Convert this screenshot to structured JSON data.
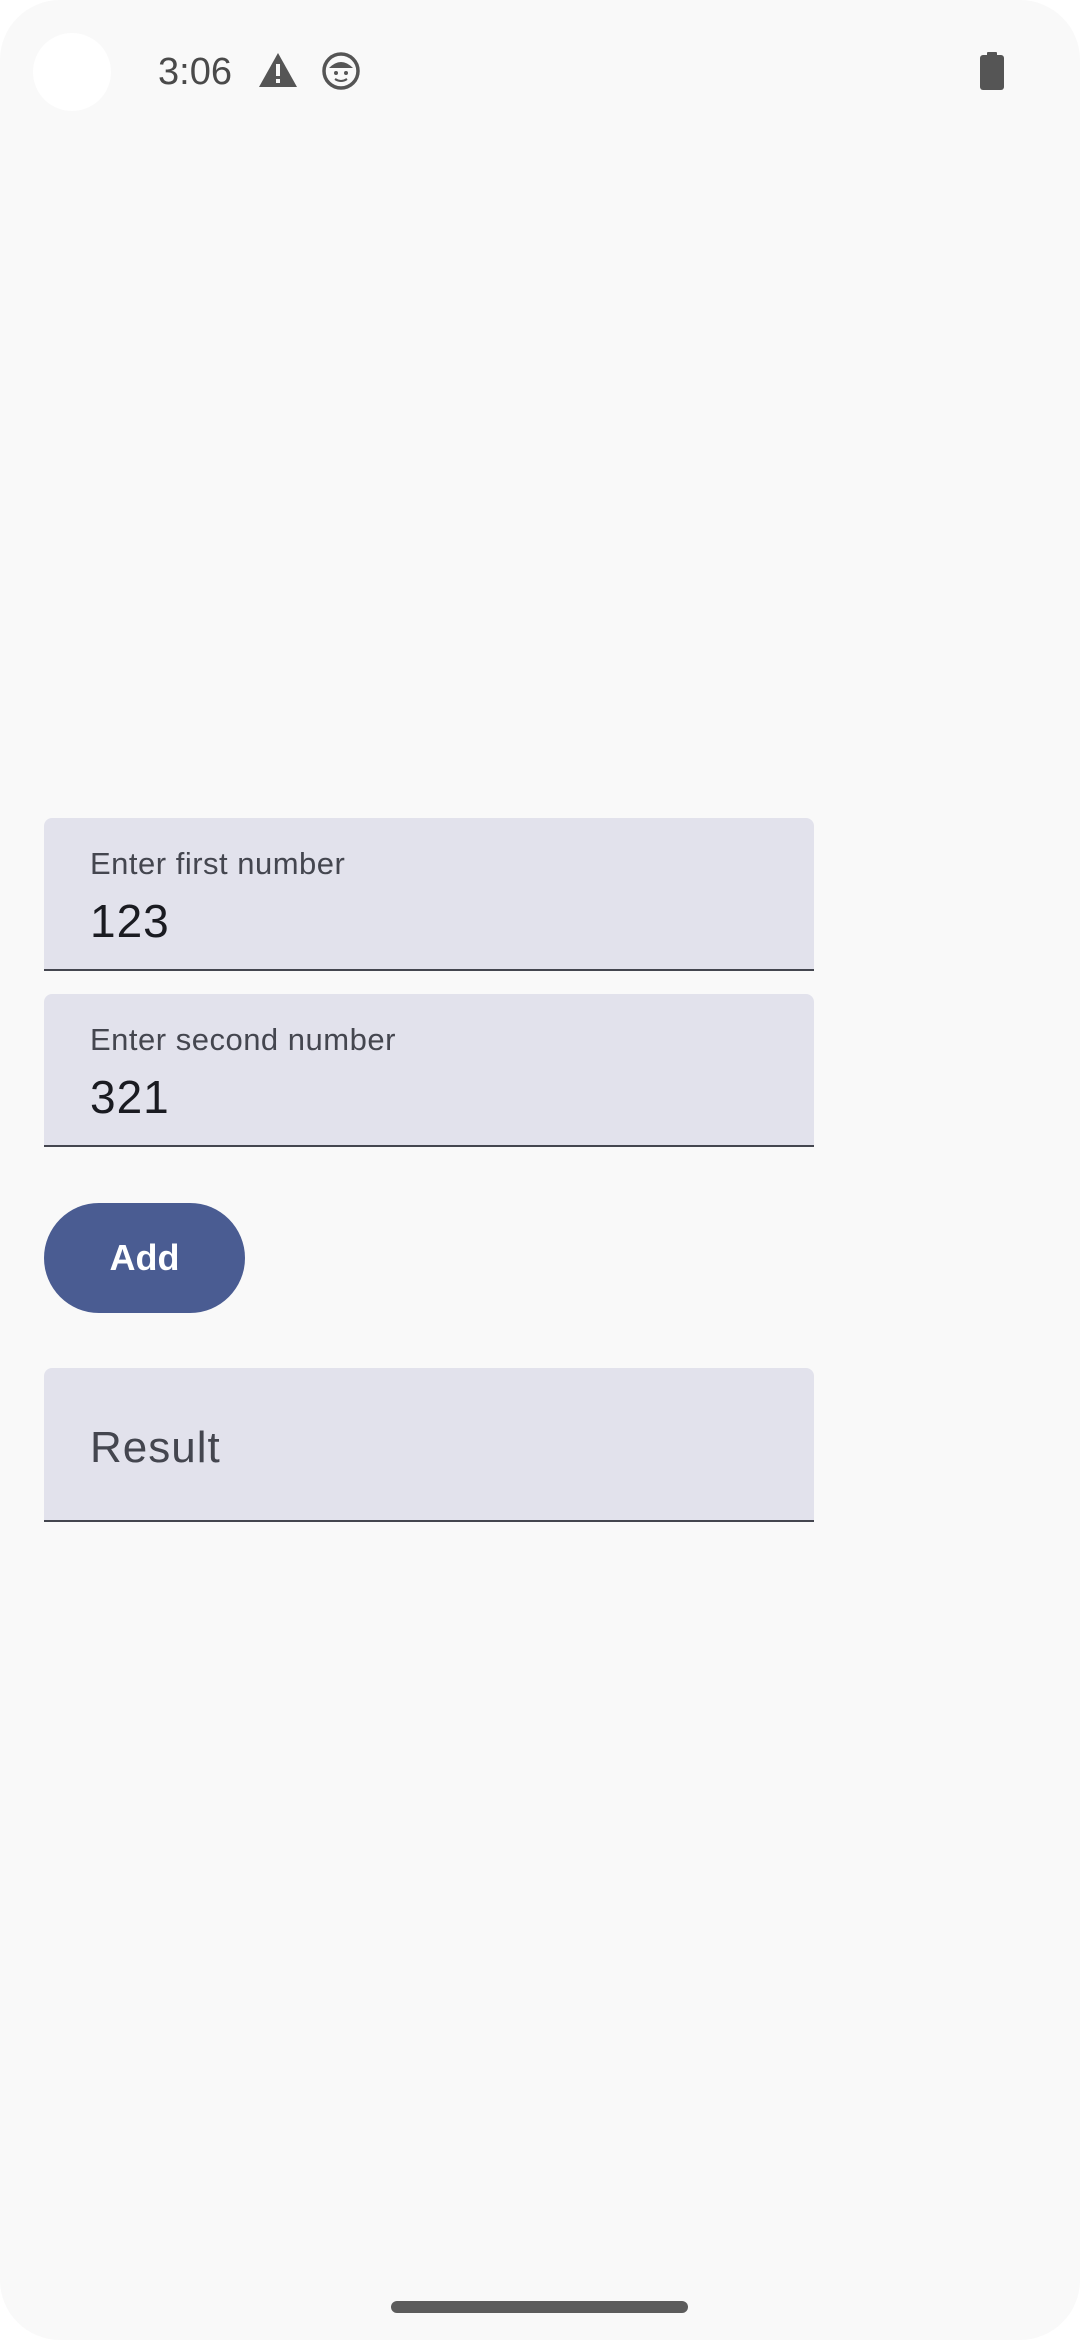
{
  "status_bar": {
    "time": "3:06",
    "icons": [
      "warning-icon",
      "face-icon",
      "battery-icon"
    ]
  },
  "form": {
    "first_field": {
      "label": "Enter first number",
      "value": "123"
    },
    "second_field": {
      "label": "Enter second number",
      "value": "321"
    },
    "add_button_label": "Add",
    "result_field": {
      "placeholder": "Result",
      "value": ""
    }
  },
  "colors": {
    "background": "#f9f9f9",
    "field_background": "#e2e2ec",
    "primary": "#4a5c92",
    "on_primary": "#ffffff",
    "label_text": "#44464f",
    "value_text": "#1a1b21"
  }
}
